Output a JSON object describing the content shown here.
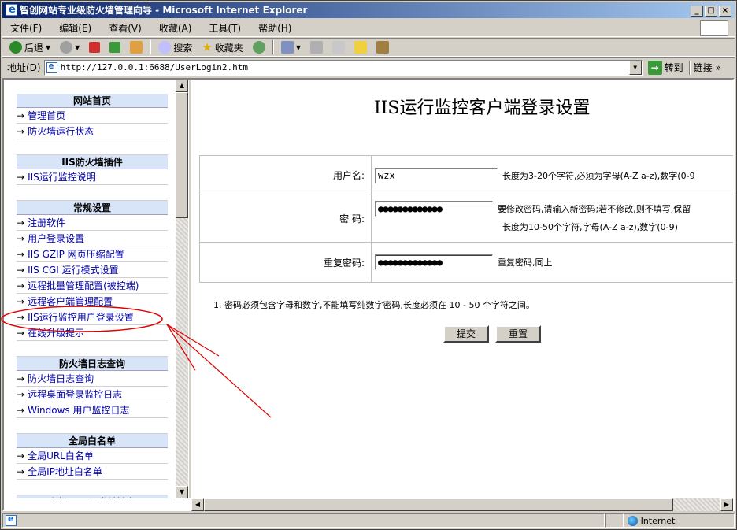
{
  "window": {
    "title": "智创网站专业级防火墙管理向导 - Microsoft Internet Explorer"
  },
  "menubar": {
    "items": [
      "文件(F)",
      "编辑(E)",
      "查看(V)",
      "收藏(A)",
      "工具(T)",
      "帮助(H)"
    ]
  },
  "toolbar": {
    "back": "后退",
    "search": "搜索",
    "favorites": "收藏夹"
  },
  "address": {
    "label": "地址(D)",
    "url": "http://127.0.0.1:6688/UserLogin2.htm",
    "go": "转到",
    "links": "链接"
  },
  "nav": {
    "sections": [
      {
        "header": "网站首页",
        "items": [
          "管理首页",
          "防火墙运行状态"
        ]
      },
      {
        "header": "IIS防火墙插件",
        "items": [
          "IIS运行监控说明"
        ]
      },
      {
        "header": "常规设置",
        "items": [
          "注册软件",
          "用户登录设置",
          "IIS GZIP 网页压缩配置",
          "IIS CGI 运行模式设置",
          "远程批量管理配置(被控端)",
          "远程客户端管理配置",
          "IIS运行监控用户登录设置",
          "在线升级提示"
        ]
      },
      {
        "header": "防火墙日志查询",
        "items": [
          "防火墙日志查询",
          "远程桌面登录监控日志",
          "Windows 用户监控日志"
        ]
      },
      {
        "header": "全局白名单",
        "items": [
          "全局URL白名单",
          "全局IP地址白名单"
        ]
      },
      {
        "header": "上级LDC下发关键字",
        "items": []
      }
    ]
  },
  "form": {
    "title": "IIS运行监控客户端登录设置",
    "username_label": "用户名:",
    "username_value": "wzx",
    "username_hint": "长度为3-20个字符,必须为字母(A-Z a-z),数字(0-9",
    "password_label": "密  码:",
    "password_value": "●●●●●●●●●●●●●",
    "password_hint": "要修改密码,请输入新密码;若不修改,则不填写,保留",
    "password_hint2": "长度为10-50个字符,字母(A-Z a-z),数字(0-9)",
    "confirm_label": "重复密码:",
    "confirm_value": "●●●●●●●●●●●●●",
    "confirm_hint": "重复密码,同上",
    "note": "1.  密码必须包含字母和数字,不能填写纯数字密码,长度必须在 10 - 50 个字符之间。",
    "submit": "提交",
    "reset": "重置"
  },
  "status": {
    "zone": "Internet"
  },
  "colors": {
    "title_start": "#0a246a",
    "title_end": "#a6caf0",
    "annotation": "#e00000",
    "link": "#0000aa"
  }
}
